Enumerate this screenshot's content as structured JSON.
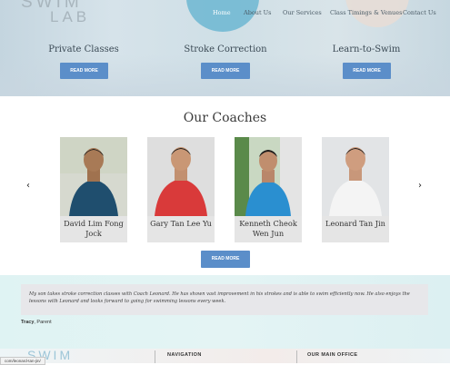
{
  "brand": {
    "line1": "SWIM",
    "line2": "LAB"
  },
  "nav": [
    {
      "label": "Home",
      "active": true
    },
    {
      "label": "About Us",
      "active": false
    },
    {
      "label": "Our Services",
      "active": false
    },
    {
      "label": "Class Timings & Venues",
      "active": false
    },
    {
      "label": "Contact Us",
      "active": false
    }
  ],
  "services": [
    {
      "title": "Private Classes",
      "button": "READ MORE"
    },
    {
      "title": "Stroke Correction",
      "button": "READ MORE"
    },
    {
      "title": "Learn-to-Swim",
      "button": "READ MORE"
    }
  ],
  "coaches": {
    "title": "Our Coaches",
    "items": [
      {
        "name": "David Lim Fong Jock",
        "shirt": "#1f4e6e"
      },
      {
        "name": "Gary Tan Lee Yu",
        "shirt": "#d93a3a"
      },
      {
        "name": "Kenneth Cheok Wen Jun",
        "shirt": "#2a8fd0"
      },
      {
        "name": "Leonard Tan Jin",
        "shirt": "#f4f4f4"
      }
    ],
    "prev_icon": "chevron-left-icon",
    "next_icon": "chevron-right-icon",
    "prev_glyph": "‹",
    "next_glyph": "›",
    "button": "READ MORE"
  },
  "testimonial": {
    "quote": "My son takes stroke correction classes with Coach Leonard. He has shown vast improvement in his strokes and is able to swim efficiently now. He also enjoys the lessons with Leonard and looks forward to going for swimming lessons every week.",
    "author": "Tracy",
    "role": ", Parent"
  },
  "footer": {
    "logo": "SWIM",
    "navigation_heading": "NAVIGATION",
    "office_heading": "OUR MAIN OFFICE"
  },
  "status_url": "com/leonard-tan-jin/",
  "colors": {
    "accent": "#5b8ec9",
    "testimonial_bg": "#e0f3f3"
  }
}
